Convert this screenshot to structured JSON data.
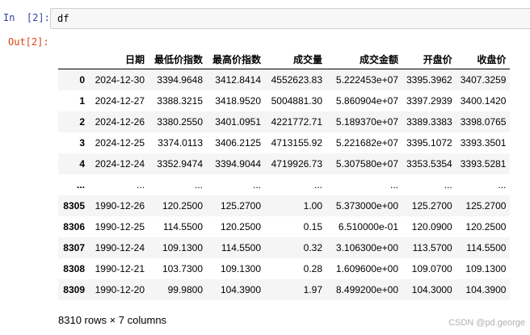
{
  "input_cell": {
    "prompt": "In  [2]:",
    "code": "df"
  },
  "output_cell": {
    "prompt": "Out[2]:"
  },
  "dataframe": {
    "columns": [
      "",
      "日期",
      "最低价指数",
      "最高价指数",
      "成交量",
      "成交金额",
      "开盘价",
      "收盘价"
    ],
    "rows": [
      [
        "0",
        "2024-12-30",
        "3394.9648",
        "3412.8414",
        "4552623.83",
        "5.222453e+07",
        "3395.3962",
        "3407.3259"
      ],
      [
        "1",
        "2024-12-27",
        "3388.3215",
        "3418.9520",
        "5004881.30",
        "5.860904e+07",
        "3397.2939",
        "3400.1420"
      ],
      [
        "2",
        "2024-12-26",
        "3380.2550",
        "3401.0951",
        "4221772.71",
        "5.189370e+07",
        "3389.3383",
        "3398.0765"
      ],
      [
        "3",
        "2024-12-25",
        "3374.0113",
        "3406.2125",
        "4713155.92",
        "5.221682e+07",
        "3395.1072",
        "3393.3501"
      ],
      [
        "4",
        "2024-12-24",
        "3352.9474",
        "3394.9044",
        "4719926.73",
        "5.307580e+07",
        "3353.5354",
        "3393.5281"
      ],
      [
        "...",
        "...",
        "...",
        "...",
        "...",
        "...",
        "...",
        "..."
      ],
      [
        "8305",
        "1990-12-26",
        "120.2500",
        "125.2700",
        "1.00",
        "5.373000e+00",
        "125.2700",
        "125.2700"
      ],
      [
        "8306",
        "1990-12-25",
        "114.5500",
        "120.2500",
        "0.15",
        "6.510000e-01",
        "120.0900",
        "120.2500"
      ],
      [
        "8307",
        "1990-12-24",
        "109.1300",
        "114.5500",
        "0.32",
        "3.106300e+00",
        "113.5700",
        "114.5500"
      ],
      [
        "8308",
        "1990-12-21",
        "103.7300",
        "109.1300",
        "0.28",
        "1.609600e+00",
        "109.0700",
        "109.1300"
      ],
      [
        "8309",
        "1990-12-20",
        "99.9800",
        "104.3900",
        "1.97",
        "8.499200e+00",
        "104.3000",
        "104.3900"
      ]
    ],
    "shape_text": "8310 rows × 7 columns"
  },
  "watermark": "CSDN @pd.george"
}
